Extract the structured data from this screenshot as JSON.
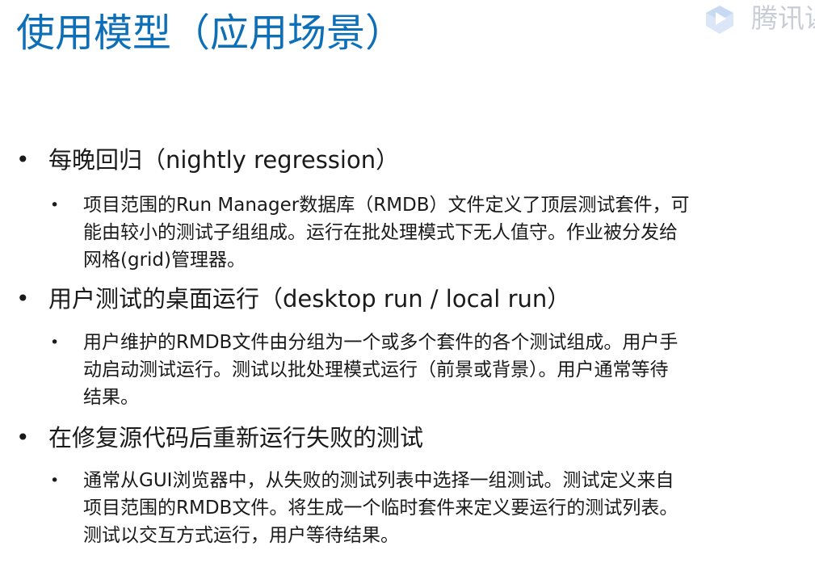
{
  "title": "使用模型（应用场景）",
  "watermark": {
    "text": "腾讯课",
    "logo_icon": "tencent-classroom-play-icon"
  },
  "sections": [
    {
      "heading": "每晚回归（nightly regression）",
      "detail_lines": [
        "项目范围的Run Manager数据库（RMDB）文件定义了顶层测试套件，可",
        "能由较小的测试子组组成。运行在批处理模式下无人值守。作业被分发给",
        "网格(grid)管理器。"
      ]
    },
    {
      "heading": "用户测试的桌面运行（desktop run / local run）",
      "detail_lines": [
        "用户维护的RMDB文件由分组为一个或多个套件的各个测试组成。用户手",
        "动启动测试运行。测试以批处理模式运行（前景或背景）。用户通常等待",
        "结果。"
      ]
    },
    {
      "heading": "在修复源代码后重新运行失败的测试",
      "detail_lines": [
        "通常从GUI浏览器中，从失败的测试列表中选择一组测试。测试定义来自",
        "项目范围的RMDB文件。将生成一个临时套件来定义要运行的测试列表。",
        "测试以交互方式运行，用户等待结果。"
      ]
    }
  ],
  "bullet_char": "•",
  "colors": {
    "title": "#0d6fb8",
    "body": "#1a1a1a",
    "watermark": "#c9ced6"
  }
}
